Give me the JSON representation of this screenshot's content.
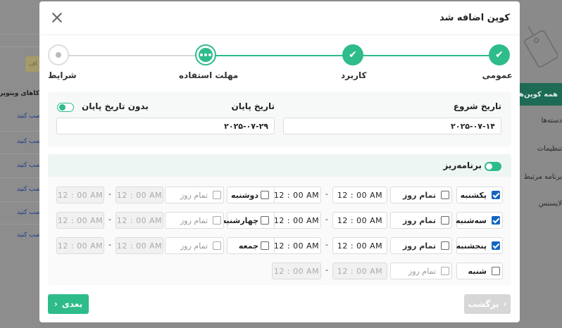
{
  "background": {
    "left_button": "اف",
    "left_title": "کاهای ویتوپرس",
    "left_links": [
      "نصب کنید",
      "نصب کنید",
      "نصب کنید",
      "نصب کنید",
      "نصب کنید",
      "نصب کنید"
    ],
    "right_active_tab": "همه کوپن‌ها",
    "right_menu": [
      "دسته‌ها",
      "تنظیمات",
      "برنامه مرتبط",
      "لایسنس"
    ]
  },
  "modal": {
    "title": "کوپن اضافه شد",
    "steps": [
      {
        "label": "عمومی",
        "state": "done"
      },
      {
        "label": "کاربرد",
        "state": "done"
      },
      {
        "label": "مهلت استفاده",
        "state": "current"
      },
      {
        "label": "شرایط",
        "state": "pending"
      }
    ],
    "dates": {
      "start_label": "تاریخ شروع",
      "start_value": "۲۰۲۵-۰۷-۱۴",
      "end_label": "تاریخ پایان",
      "end_value": "۲۰۲۵-۰۷-۲۹",
      "no_end_label": "بدون تاریخ پایان"
    },
    "schedule": {
      "title": "برنامه‌ریز",
      "allday_label": "تمام روز",
      "time_value": "12 : 00  AM",
      "days": [
        {
          "name": "یکشنبه",
          "checked": true
        },
        {
          "name": "سه‌شنبه",
          "checked": true
        },
        {
          "name": "پنجشنبه",
          "checked": true
        },
        {
          "name": "شنبه",
          "checked": false
        },
        {
          "name": "دوشنبه",
          "checked": false
        },
        {
          "name": "چهارشنبه",
          "checked": false
        },
        {
          "name": "جمعه",
          "checked": false
        }
      ]
    },
    "buttons": {
      "next": "بعدی",
      "back": "برگشت"
    }
  },
  "colors": {
    "accent": "#2ebc8a",
    "checkbox": "#1565c0"
  }
}
